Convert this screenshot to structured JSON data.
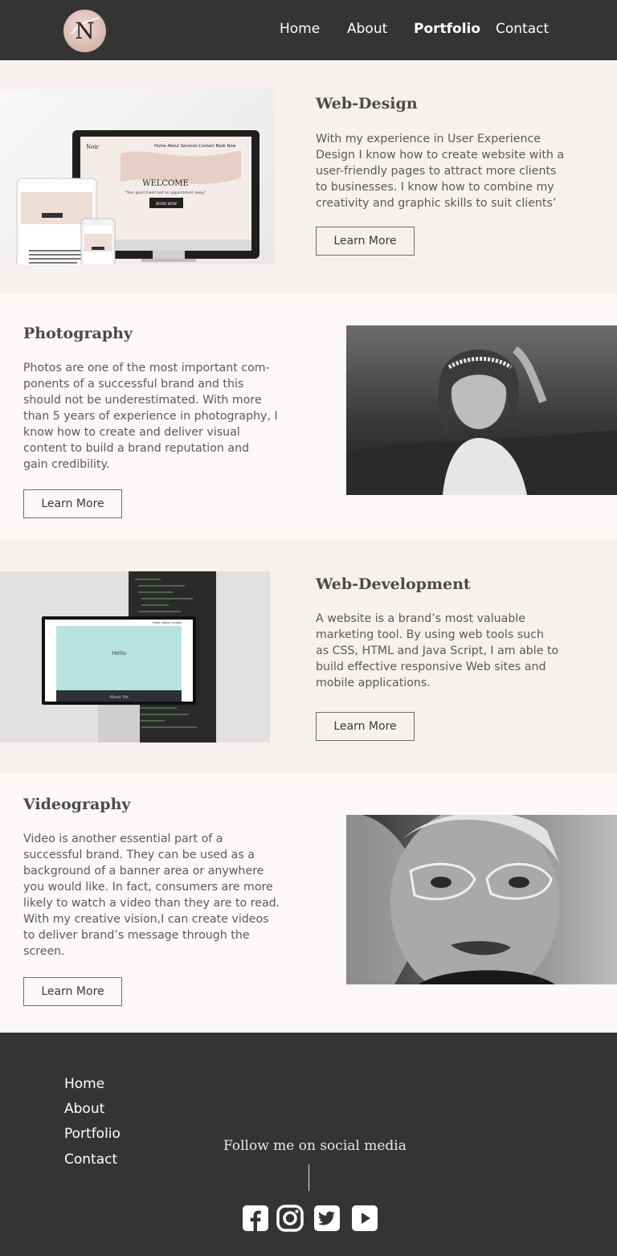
{
  "header": {
    "logo_letter": "N",
    "nav": [
      "Home",
      "About",
      "Portfolio",
      "Contact"
    ],
    "active_nav": "Portfolio"
  },
  "sections": [
    {
      "title": "Web-Design",
      "lines": [
        "With my experience in User Experience",
        "Design I know how to create website with a",
        "user-friendly pages to attract more  clients",
        "to businesses. I  know how to combine my",
        "creativity and graphic skills to suit  clients’"
      ],
      "button": "Learn More",
      "image": {
        "brand": "Noir",
        "menu": "Home  About  Services  Contact  Book Now",
        "welcome": "WELCOME",
        "tagline": "\"Your good mood just an appointment away\"",
        "cta": "BOOK NOW"
      }
    },
    {
      "title": "Photography",
      "lines": [
        "Photos are one of the most important com-",
        "ponents of a successful brand and this",
        "should not be underestimated. With more",
        "than 5 years of experience in photography, I",
        "know how to create and deliver visual",
        "content to build a brand reputation and",
        "gain credibility."
      ],
      "button": "Learn More"
    },
    {
      "title": "Web-Development",
      "lines": [
        "A website is a brand’s most valuable",
        "marketing tool. By using web tools such",
        "as CSS, HTML and Java Script, I am able to",
        "build effective responsive Web sites and",
        "mobile applications."
      ],
      "button": "Learn More",
      "image": {
        "hello": "Hello",
        "about": "About Me",
        "menu": "Home  About  Contact"
      }
    },
    {
      "title": "Videography",
      "lines": [
        "Video is another essential part of a",
        "successful brand. They can be used as  a",
        "background of a banner area or anywhere",
        "you would like. In fact, consumers are more",
        "likely to watch a video than they are to read.",
        "With my creative vision,I can create videos",
        "to deliver brand’s message through the",
        "screen."
      ],
      "button": "Learn More"
    }
  ],
  "footer": {
    "links": [
      "Home",
      "About",
      "Portfolio",
      "Contact"
    ],
    "follow": "Follow me on social media",
    "social_icons": [
      "facebook-icon",
      "instagram-icon",
      "twitter-icon",
      "youtube-icon"
    ]
  },
  "colors": {
    "header_bg": "#353434",
    "section_alt_bg": "#f6f1ef",
    "section_bg": "#fcf8f7",
    "text": "#5a5a5a",
    "logo_pink": "#d7b8b0"
  }
}
